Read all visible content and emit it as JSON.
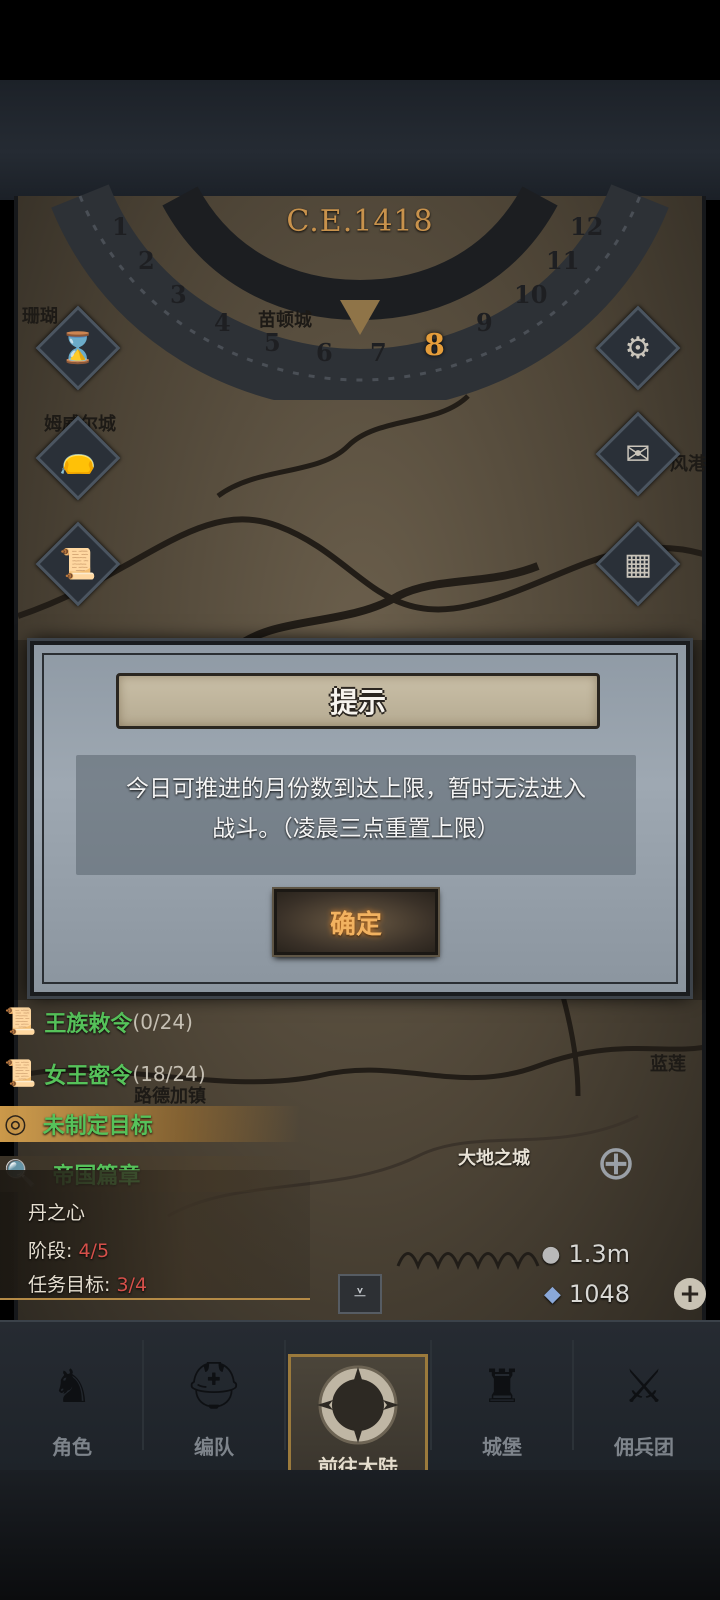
{
  "dial": {
    "year": "C.E.1418",
    "months": [
      "1",
      "2",
      "3",
      "4",
      "5",
      "6",
      "7",
      "8",
      "9",
      "10",
      "11",
      "12"
    ],
    "current_month": "8"
  },
  "map": {
    "cities": [
      {
        "name": "珊瑚",
        "style": "dark"
      },
      {
        "name": "苗顿城",
        "style": "dark"
      },
      {
        "name": "姆威尔城",
        "style": "dark"
      },
      {
        "name": "风港",
        "style": "dark"
      },
      {
        "name": "路德加镇",
        "style": "light"
      },
      {
        "name": "大地之城",
        "style": "light"
      },
      {
        "name": "蓝莲",
        "style": "dark"
      }
    ]
  },
  "side_buttons": [
    {
      "icon": "hourglass-icon",
      "glyph": "⌛"
    },
    {
      "icon": "bag-icon",
      "glyph": "👝"
    },
    {
      "icon": "scroll-icon",
      "glyph": "📜"
    },
    {
      "icon": "gear-icon",
      "glyph": "⚙"
    },
    {
      "icon": "mail-icon",
      "glyph": "✉"
    },
    {
      "icon": "grid-icon",
      "glyph": "▦"
    }
  ],
  "quests": {
    "royal_decree": {
      "label": "王族敕令",
      "count": "(0/24)"
    },
    "queen_order": {
      "label": "女王密令",
      "count": "(18/24)"
    },
    "goal": "未制定目标",
    "chapter": "帝国篇章",
    "story_title": "丹之心",
    "stage_label": "阶段:",
    "stage_value": "4/5",
    "task_label": "任务目标:",
    "task_value": "3/4"
  },
  "resources": {
    "silver": "1.3m",
    "crystal": "1048"
  },
  "dialog": {
    "title": "提示",
    "message_line1": "今日可推进的月份数到达上限，暂时无法进入",
    "message_line2": "战斗。（凌晨三点重置上限）",
    "ok_label": "确定"
  },
  "nav": [
    {
      "label": "角色",
      "icon": "knight-icon"
    },
    {
      "label": "编队",
      "icon": "helmet-icon"
    },
    {
      "label": "前往大陆",
      "icon": "compass-icon"
    },
    {
      "label": "城堡",
      "icon": "castle-icon"
    },
    {
      "label": "佣兵团",
      "icon": "mercenary-icon"
    }
  ],
  "colors": {
    "accent_gold": "#e59d3a",
    "quest_green": "#56c25a",
    "progress_red": "#d6504a"
  }
}
